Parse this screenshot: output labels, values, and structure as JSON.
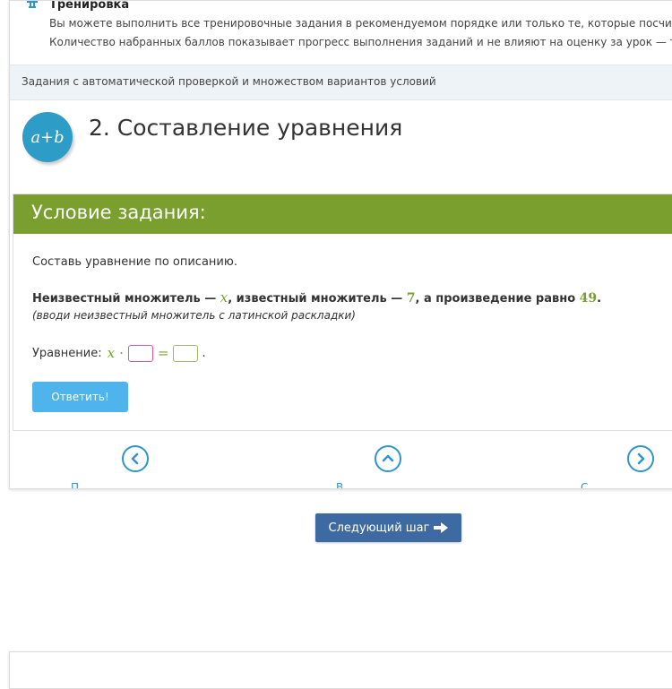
{
  "training": {
    "title": "Тренировка",
    "line1": "Вы можете выполнить все тренировочные задания в рекомендуемом порядке или только те, которые посчитаете н",
    "line2": "Количество набранных баллов показывает прогресс выполнения заданий и не влияют на оценку за урок — трениро"
  },
  "section": {
    "label": "Задания с автоматической проверкой и множеством вариантов условий"
  },
  "exercise": {
    "badge": "a+b",
    "title": "2. Составление уравнения"
  },
  "task": {
    "header": "Условие задания:",
    "intro": "Составь уравнение по описанию.",
    "main_prefix": "Неизвестный множитель — ",
    "main_var": "x",
    "main_mid": ", известный множитель — ",
    "main_num1": "7",
    "main_suffix": ", а произведение равно ",
    "main_num2": "49",
    "main_end": ".",
    "hint": "(вводи неизвестный множитель с латинской раскладки)",
    "equation_label": "Уравнение:",
    "eq_var": "x",
    "eq_dot": "·",
    "eq_equals": "=",
    "eq_end": ".",
    "answer_button": "Ответить!"
  },
  "nav": {
    "prev_label": "П",
    "up_label": "В",
    "next_label": "С"
  },
  "next_step_button": "Следующий шаг",
  "colors": {
    "accent_green": "#7a9f2e",
    "button_blue": "#4fb3ec",
    "nav_blue": "#2e95cf",
    "next_step_blue": "#3d6aa3",
    "badge_blue": "#2d9dc7"
  }
}
